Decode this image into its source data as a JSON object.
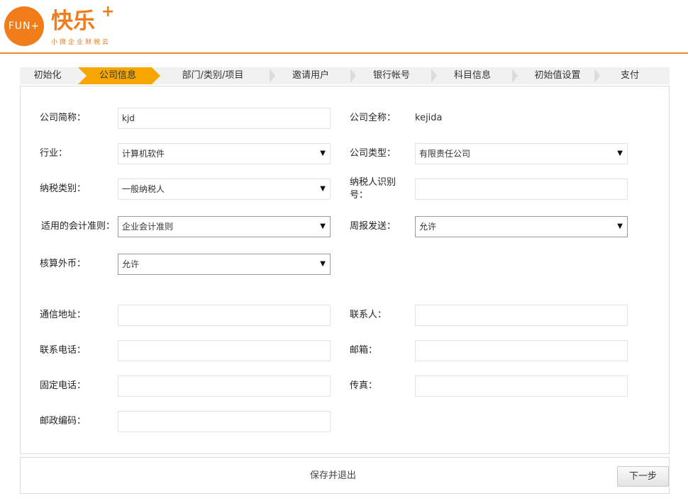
{
  "header": {
    "logo_text": "FUN+",
    "brand": "快乐",
    "brand_plus": "+",
    "tagline": "小微企业财税云"
  },
  "steps": [
    {
      "label": "初始化",
      "active": false
    },
    {
      "label": "公司信息",
      "active": true
    },
    {
      "label": "部门/类别/项目",
      "active": false
    },
    {
      "label": "邀请用户",
      "active": false
    },
    {
      "label": "银行帐号",
      "active": false
    },
    {
      "label": "科目信息",
      "active": false
    },
    {
      "label": "初始值设置",
      "active": false
    },
    {
      "label": "支付",
      "active": false
    }
  ],
  "form": {
    "short_name": {
      "label": "公司简称：",
      "value": "kjd"
    },
    "full_name": {
      "label": "公司全称：",
      "value": "kejida"
    },
    "industry": {
      "label": "行业：",
      "value": "计算机软件"
    },
    "company_type": {
      "label": "公司类型：",
      "value": "有限责任公司"
    },
    "tax_type": {
      "label": "纳税类别：",
      "value": "一般纳税人"
    },
    "taxpayer_id": {
      "label_line1": "纳税人识别",
      "label_line2": "号：",
      "value": ""
    },
    "accounting_standard": {
      "label": "适用的会计准则：",
      "value": "企业会计准则"
    },
    "weekly_report": {
      "label": "周报发送：",
      "value": "允许"
    },
    "foreign_currency": {
      "label": "核算外币：",
      "value": "允许"
    },
    "address": {
      "label": "通信地址：",
      "value": ""
    },
    "contact": {
      "label": "联系人：",
      "value": ""
    },
    "phone": {
      "label": "联系电话：",
      "value": ""
    },
    "email": {
      "label": "邮箱：",
      "value": ""
    },
    "landline": {
      "label": "固定电话：",
      "value": ""
    },
    "fax": {
      "label": "传真：",
      "value": ""
    },
    "postcode": {
      "label": "邮政编码：",
      "value": ""
    }
  },
  "footer": {
    "save_exit": "保存并退出",
    "next": "下一步"
  },
  "colors": {
    "brand_orange": "#f07c1a",
    "active_step": "#f5a700"
  }
}
